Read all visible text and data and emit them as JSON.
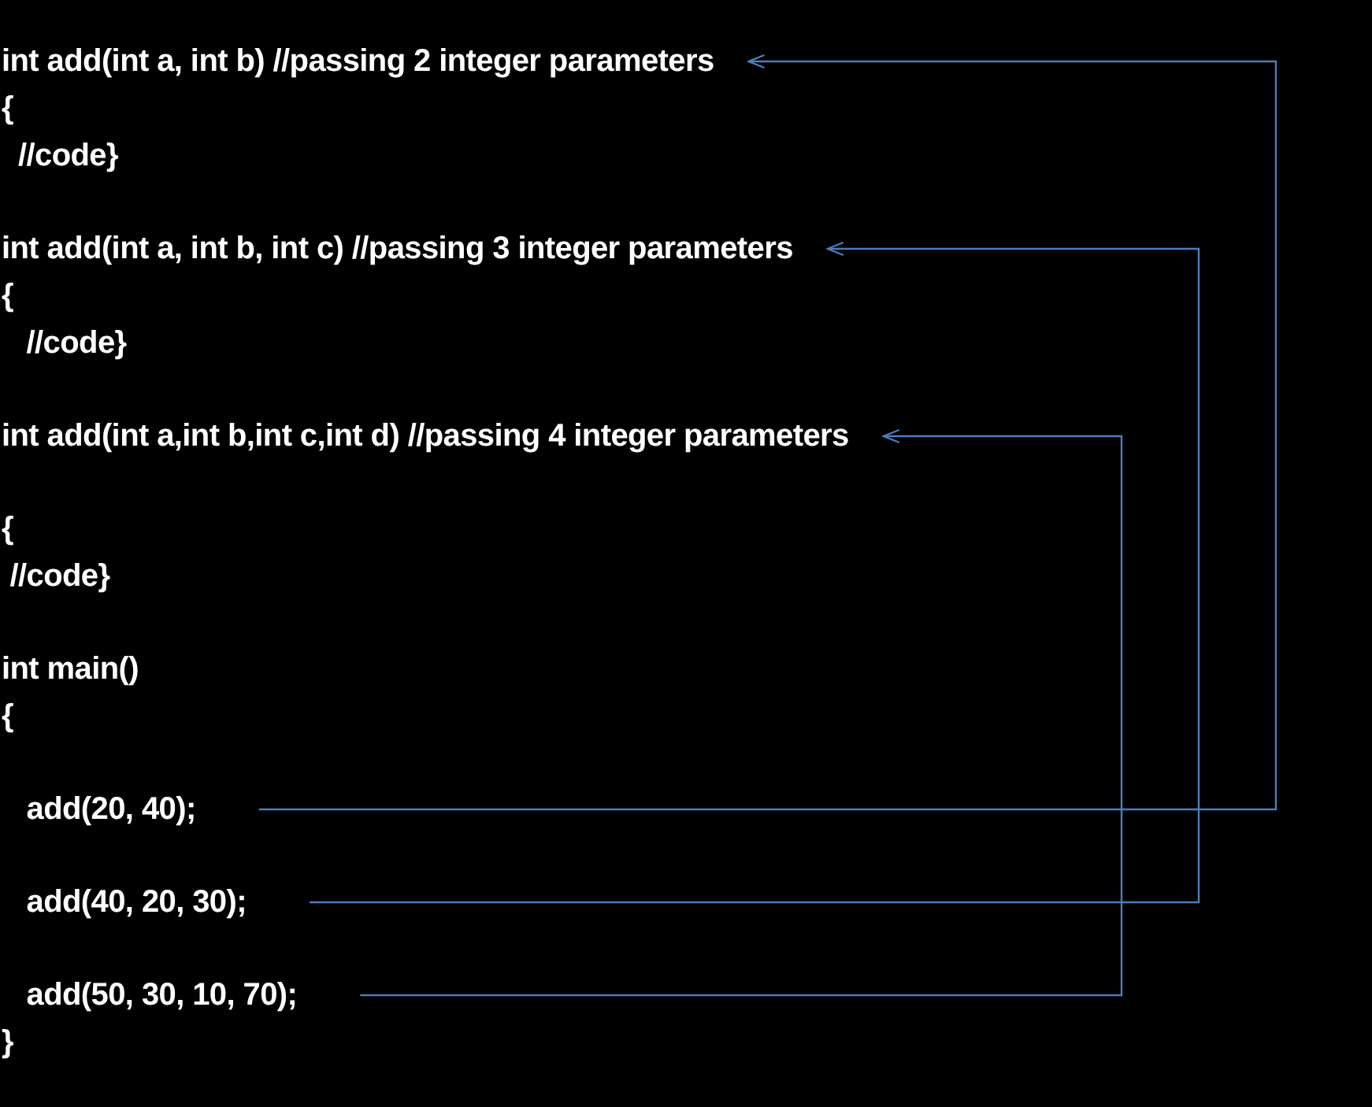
{
  "blocks": [
    {
      "kind": "definition",
      "lines": [
        "int add(int a, int b) //passing 2 integer parameters",
        "{",
        "  //code}"
      ]
    },
    {
      "kind": "definition",
      "lines": [
        "int add(int a, int b, int c) //passing 3 integer parameters",
        "{",
        "   //code}"
      ]
    },
    {
      "kind": "definition",
      "lines": [
        "int add(int a,int b,int c,int d) //passing 4 integer parameters"
      ]
    },
    {
      "kind": "plain",
      "lines": [
        "{",
        " //code}"
      ]
    },
    {
      "kind": "plain",
      "lines": [
        "int main()",
        "{"
      ]
    },
    {
      "kind": "call",
      "lines": [
        "   add(20, 40);"
      ]
    },
    {
      "kind": "call",
      "lines": [
        "   add(40, 20, 30);"
      ]
    },
    {
      "kind": "call",
      "lines": [
        "   add(50, 30, 10, 70);",
        "}"
      ]
    }
  ]
}
